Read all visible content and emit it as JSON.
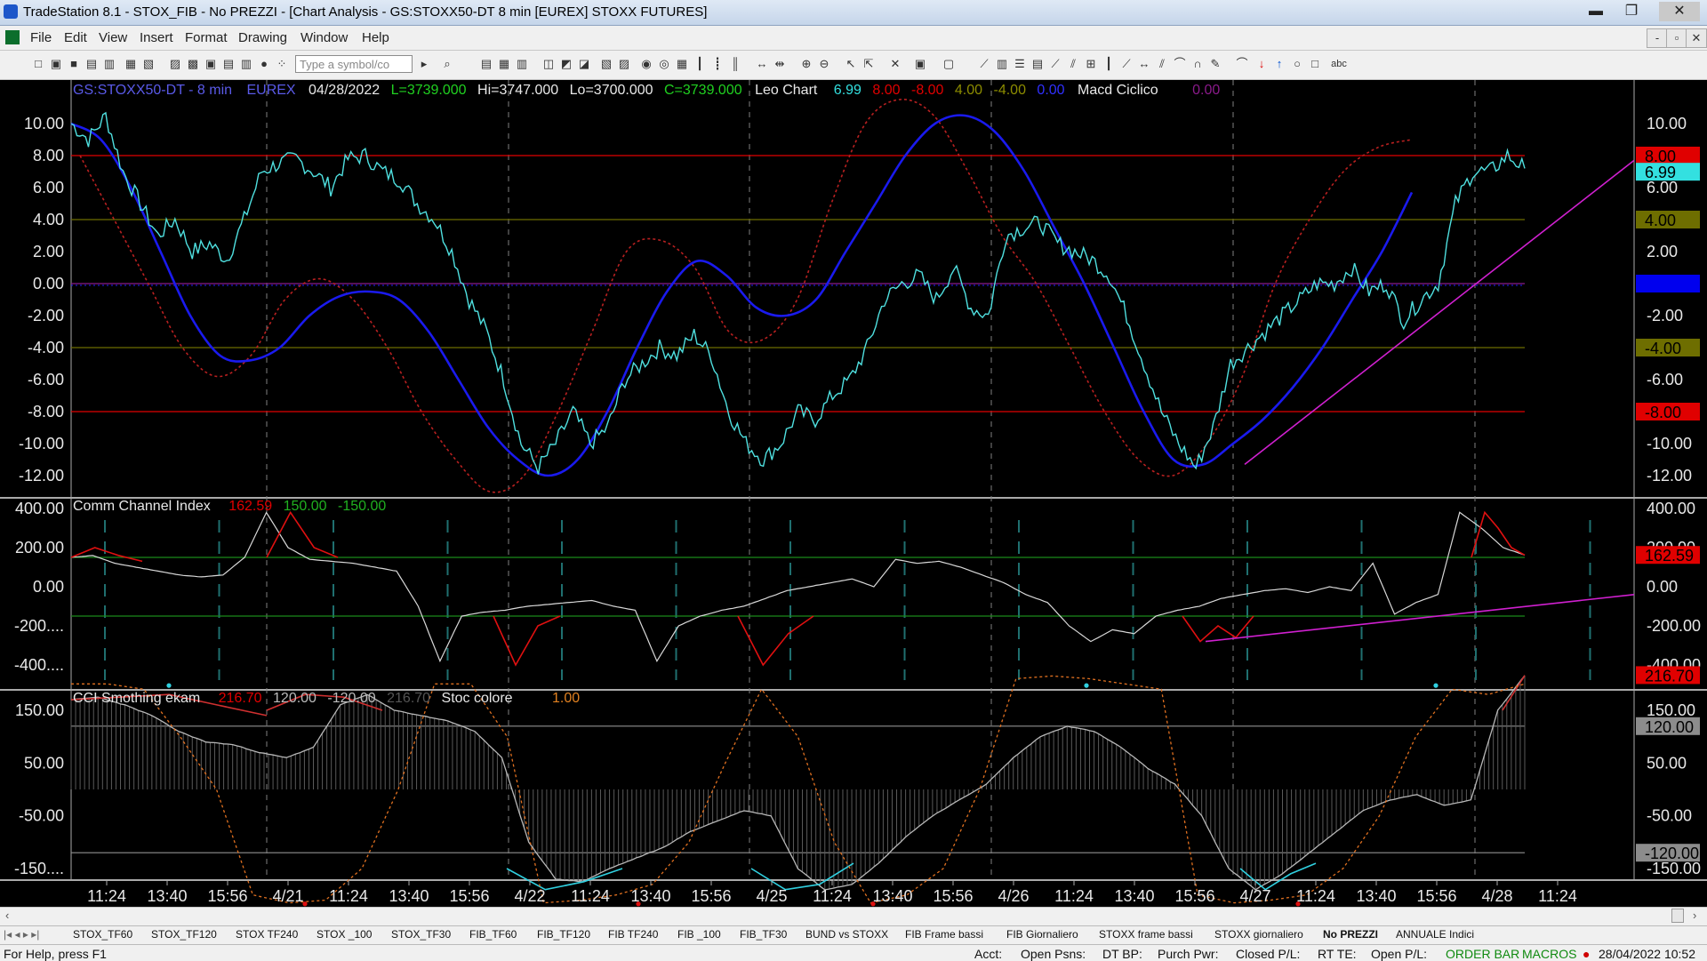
{
  "window": {
    "title": "TradeStation 8.1 - STOX_FIB - No PREZZI - [Chart Analysis - GS:STOXX50-DT  8 min  [EUREX] STOXX FUTURES]",
    "controls": {
      "minimize": "▬",
      "maximize": "❐",
      "close": "✕"
    }
  },
  "menu": {
    "items": [
      "File",
      "Edit",
      "View",
      "Insert",
      "Format",
      "Drawing",
      "Window",
      "Help"
    ],
    "mdi_controls": [
      "-",
      "▫",
      "✕"
    ]
  },
  "toolbar": {
    "symbol_placeholder": "Type a symbol/co"
  },
  "chart": {
    "header": {
      "symbol": "GS:STOXX50-DT - 8 min",
      "exchange": "EUREX",
      "date": "04/28/2022",
      "last": "L=3739.000",
      "high": "Hi=3747.000",
      "low": "Lo=3700.000",
      "close": "C=3739.000",
      "study": "Leo Chart",
      "v1": "6.99",
      "v2": "8.00",
      "v3": "-8.00",
      "v4": "4.00",
      "v5": "-4.00",
      "v6": "0.00",
      "study2": "Macd Ciclico",
      "v7": "0.00"
    },
    "panel1_ticks": [
      "10.00",
      "8.00",
      "6.00",
      "4.00",
      "2.00",
      "0.00",
      "-2.00",
      "-4.00",
      "-6.00",
      "-8.00",
      "-10.00",
      "-12.00"
    ],
    "panel1_tick_values": [
      10,
      8,
      6,
      4,
      2,
      0,
      -2,
      -4,
      -6,
      -8,
      -10,
      -12
    ],
    "panel1_markers": [
      {
        "label": "8.00",
        "value": 8,
        "bg": "#e00000",
        "fg": "#000000"
      },
      {
        "label": "6.99",
        "value": 6.99,
        "bg": "#33e0e0",
        "fg": "#000000"
      },
      {
        "label": "4.00",
        "value": 4,
        "bg": "#6e6e00",
        "fg": "#000000"
      },
      {
        "label": "0.00",
        "value": 0,
        "bg": "#0000ee",
        "fg": "#0000ee"
      },
      {
        "label": "-4.00",
        "value": -4,
        "bg": "#6e6e00",
        "fg": "#000000"
      },
      {
        "label": "-8.00",
        "value": -8,
        "bg": "#e00000",
        "fg": "#000000"
      }
    ],
    "panel2": {
      "title": "Comm Channel Index",
      "value": "162.59",
      "upper": "150.00",
      "lower": "-150.00",
      "ticks_left": [
        "400.00",
        "200.00",
        "0.00",
        "-200....",
        "-400...."
      ],
      "ticks_right": [
        "400.00",
        "200.00",
        "0.00",
        "-200.00",
        "-400.00"
      ],
      "tick_values": [
        400,
        200,
        0,
        -200,
        -400
      ],
      "marker": {
        "label": "162.59",
        "value": 162.59
      }
    },
    "panel3": {
      "title": "CCI Smothing ekam",
      "value": "216.70",
      "upper": "120.00",
      "lower": "-120.00",
      "value2": "216.70",
      "study2": "Stoc colore",
      "value3": "1.00",
      "ticks_left": [
        "150.00",
        "50.00",
        "-50.00",
        "-150...."
      ],
      "ticks_right": [
        "150.00",
        "50.00",
        "-50.00",
        "-150.00"
      ],
      "tick_values": [
        150,
        50,
        -50,
        -150
      ],
      "markers": [
        {
          "label": "216.70",
          "value": 216.7,
          "bg": "#e00000",
          "fg": "#000000"
        },
        {
          "label": "120.00",
          "value": 120,
          "bg": "#8c8c8c",
          "fg": "#000000"
        },
        {
          "label": "-120.00",
          "value": -120,
          "bg": "#8c8c8c",
          "fg": "#000000"
        }
      ]
    },
    "time_labels": [
      "11:24",
      "13:40",
      "15:56",
      "4/21",
      "11:24",
      "13:40",
      "15:56",
      "4/22",
      "11:24",
      "13:40",
      "15:56",
      "4/25",
      "11:24",
      "13:40",
      "15:56",
      "4/26",
      "11:24",
      "13:40",
      "15:56",
      "4/27",
      "11:24",
      "13:40",
      "15:56",
      "4/28",
      "11:24"
    ]
  },
  "chart_data": {
    "type": "line",
    "title": "GS:STOXX50-DT - 8 min",
    "series": [
      {
        "name": "Leo Chart",
        "color": "#4fe0e0",
        "values": [
          10,
          9,
          10.5,
          7,
          5,
          3,
          4,
          2,
          2.5,
          1.5,
          4,
          7,
          7.5,
          7.8,
          7,
          6,
          7.8,
          8,
          7,
          6.5,
          5,
          4,
          2,
          -1,
          -3,
          -6,
          -10,
          -11.5,
          -10,
          -8,
          -10,
          -9,
          -6,
          -5,
          -4,
          -4.5,
          -3.2,
          -4.5,
          -8,
          -10,
          -11,
          -10,
          -8,
          -8.5,
          -7,
          -6,
          -4,
          -1,
          0,
          0.5,
          -1,
          1,
          -1.5,
          -2,
          3,
          3.5,
          3.8,
          2.5,
          2,
          1.5,
          0.5,
          -2,
          -5,
          -8,
          -10,
          -11.5,
          -9,
          -5,
          -4,
          -3,
          -2,
          -1,
          0,
          0,
          1,
          -0.5,
          0,
          -2.3,
          -1,
          0,
          5,
          7,
          7,
          8,
          7.2
        ]
      },
      {
        "name": "Macd Ciclico",
        "color": "#1a1aee",
        "values": [
          10,
          9,
          6,
          2,
          -2,
          -4.5,
          -4.8,
          -4,
          -2,
          -0.8,
          -0.5,
          -1,
          -3,
          -6,
          -9,
          -11,
          -12,
          -11,
          -8,
          -4,
          -0.5,
          1.4,
          0.5,
          -1.5,
          -2,
          -1,
          2,
          5,
          8,
          10,
          10.5,
          9.5,
          7,
          3.5,
          0,
          -4,
          -8,
          -11,
          -11.3,
          -10,
          -8.5,
          -6.5,
          -4,
          -1,
          2,
          5.7
        ]
      },
      {
        "name": "dotted",
        "color": "#b82020",
        "values": [
          8,
          4,
          0,
          -4,
          -5.8,
          -4.5,
          -1,
          0.3,
          -1,
          -4,
          -8,
          -11,
          -13,
          -12,
          -8,
          -3,
          2,
          2.7,
          1,
          -3,
          -3.5,
          -1,
          5,
          10,
          11.5,
          10.5,
          7,
          3,
          0,
          -4,
          -8,
          -11,
          -12,
          -10,
          -6,
          0,
          4,
          7,
          8.5,
          9
        ]
      }
    ],
    "cci": {
      "upper": 150,
      "lower": -150,
      "ylim": [
        -400,
        400
      ]
    },
    "cci_smoothing": {
      "upper": 120,
      "lower": -120,
      "ylim": [
        -210,
        210
      ]
    },
    "ylim": [
      -13.5,
      12
    ]
  }
}
